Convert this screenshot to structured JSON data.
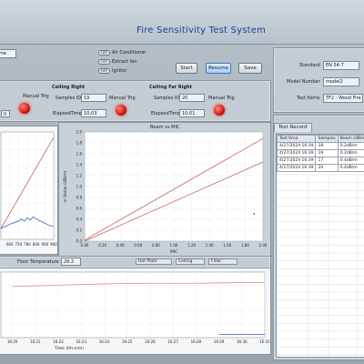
{
  "app": {
    "title": "Fire Sensitivity Test System"
  },
  "top_left": {
    "label_partial": "me"
  },
  "toggles": [
    {
      "switch": "OFF",
      "label": "Air Conditioner"
    },
    {
      "switch": "OFF",
      "label": "Extract fan"
    },
    {
      "switch": "OFF",
      "label": "Ignitor"
    }
  ],
  "buttons": {
    "start": "Start",
    "resume": "Resume",
    "save": "Save"
  },
  "right_info": {
    "standard_label": "Standard",
    "standard_value": "EN 54-7",
    "model_label": "Model Number",
    "model_value": "model2",
    "test_items_label": "Test Items",
    "test_items_value": "TF2 - Wood Fire"
  },
  "sensors": [
    {
      "title": "",
      "manual_trig": "Manual Trig",
      "elapsed_value": "0"
    },
    {
      "title": "Ceiling Right",
      "samples_label": "Samples ID",
      "samples_value": "19",
      "manual_trig": "Manual Trig",
      "elapsed_label": "ElapsedTime",
      "elapsed_value": "10:03"
    },
    {
      "title": "Ceiling Far Right",
      "samples_label": "Samples ID",
      "samples_value": "20",
      "manual_trig": "Manual Trig",
      "elapsed_label": "ElapsedTime",
      "elapsed_value": "10:01"
    }
  ],
  "chart_beam": {
    "title": "Beam vs MIC",
    "xlabel": "MIC",
    "ylabel": "m Value (dB/m)",
    "yticks": [
      "2.0",
      "1.8",
      "1.6",
      "1.4",
      "1.2",
      "1.0",
      "0.8",
      "0.6",
      "0.4",
      "0.2",
      "0.0"
    ],
    "xticks": [
      "0.00",
      "0.10",
      "0.20",
      "0.30",
      "0.40",
      "0.50",
      "0.60",
      "0.70",
      "0.80",
      "0.90",
      "1.00",
      "1.10",
      "1.20",
      "1.30",
      "1.40",
      "1.50",
      "1.60",
      "1.70",
      "1.80",
      "1.90",
      "2.00"
    ]
  },
  "chart_left": {
    "xticks": [
      "660",
      "720",
      "780",
      "840",
      "900",
      "960"
    ]
  },
  "temp_row": {
    "label": "Floor Temperature",
    "value": "29.2"
  },
  "legend": [
    {
      "label": "Hot Plate"
    },
    {
      "label": "Ceiling"
    },
    {
      "label": "Floor"
    }
  ],
  "chart_time": {
    "xlabel": "Time (hh:mm)",
    "xticks": [
      "16:20",
      "16:21",
      "16:22",
      "16:23",
      "16:24",
      "16:25",
      "16:26",
      "16:27",
      "16:28",
      "16:29",
      "16:30",
      "16:31"
    ]
  },
  "test_record": {
    "tab": "Test Record",
    "headers": [
      "Test time",
      "Samples",
      "Beam (dB/m)",
      "V"
    ],
    "rows": [
      [
        "4/27/2024 16:39",
        "18",
        "0.2dB/m",
        "N"
      ],
      [
        "4/27/2024 16:39",
        "19",
        "0.2dB/m",
        "N"
      ],
      [
        "4/27/2024 16:39",
        "17",
        "0.4dB/m",
        "N"
      ],
      [
        "4/27/2024 16:39",
        "20",
        "0.4dB/m",
        "N"
      ]
    ]
  },
  "chart_data": [
    {
      "type": "line",
      "title": "Beam vs MIC",
      "xlabel": "MIC",
      "ylabel": "m Value (dB/m)",
      "xlim": [
        0,
        2
      ],
      "ylim": [
        0,
        2
      ],
      "series": [
        {
          "x": [
            0,
            2.0
          ],
          "y": [
            0.02,
            1.88
          ]
        },
        {
          "x": [
            0,
            2.0
          ],
          "y": [
            0.0,
            1.45
          ]
        }
      ],
      "points": [
        {
          "x": 1.9,
          "y": 0.5
        }
      ]
    },
    {
      "type": "line",
      "xticks": [
        "660",
        "720",
        "780",
        "840",
        "900",
        "960"
      ],
      "series": [
        {
          "x": [
            600,
            960
          ],
          "y": [
            0.1,
            0.95
          ]
        },
        {
          "x": [
            600,
            660,
            700,
            720,
            740,
            760,
            780,
            800,
            820,
            840,
            870,
            900,
            930,
            960
          ],
          "y": [
            0.1,
            0.14,
            0.16,
            0.17,
            0.19,
            0.17,
            0.2,
            0.18,
            0.21,
            0.19,
            0.17,
            0.15,
            0.13,
            0.12
          ]
        }
      ]
    },
    {
      "type": "line",
      "xlabel": "Time (hh:mm)",
      "series": [
        {
          "name": "Hot Plate",
          "x": [
            "16:20",
            "16:22",
            "16:24",
            "16:26",
            "16:28",
            "16:30",
            "16:31"
          ],
          "y": [
            0.78,
            0.8,
            0.82,
            0.83,
            0.83,
            0.84,
            0.84
          ]
        },
        {
          "name": "Floor",
          "x": [
            "16:29",
            "16:31"
          ],
          "y": [
            0.05,
            0.05
          ]
        }
      ]
    }
  ]
}
